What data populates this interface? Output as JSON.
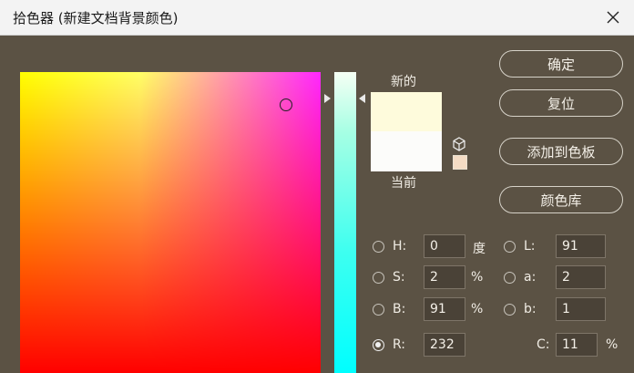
{
  "window": {
    "title": "拾色器 (新建文档背景颜色)",
    "close_glyph": "✕"
  },
  "swatch": {
    "new_label": "新的",
    "current_label": "当前",
    "new_color": "#fefbdc",
    "current_color": "#fcfcfa"
  },
  "buttons": {
    "ok": "确定",
    "reset": "复位",
    "add_to_swatches": "添加到色板",
    "color_libraries": "颜色库"
  },
  "hsb": {
    "h": {
      "label": "H:",
      "value": "0",
      "unit": "度"
    },
    "s": {
      "label": "S:",
      "value": "2",
      "unit": "%"
    },
    "b": {
      "label": "B:",
      "value": "91",
      "unit": "%"
    }
  },
  "lab": {
    "l": {
      "label": "L:",
      "value": "91"
    },
    "a": {
      "label": "a:",
      "value": "2"
    },
    "b": {
      "label": "b:",
      "value": "1"
    }
  },
  "rgb": {
    "r": {
      "label": "R:",
      "value": "232"
    }
  },
  "cmyk": {
    "c": {
      "label": "C:",
      "value": "11",
      "unit": "%"
    }
  },
  "icons": {
    "gamut_warning": "cube-icon",
    "web_safe": "web-swatch-icon"
  }
}
